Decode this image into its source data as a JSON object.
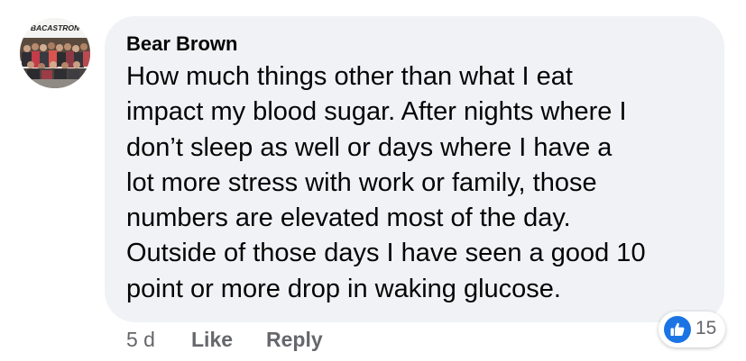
{
  "comment": {
    "author": "Bear Brown",
    "avatar_banner": "BACASTRON",
    "lines": [
      "How much things other than what I eat",
      "impact my blood sugar. After nights where I",
      "don’t sleep as well or days where I have a",
      "lot more stress with work or family, those",
      "numbers are elevated most of the day.",
      "Outside of those days I have seen a good 10",
      "point or more drop in waking glucose."
    ]
  },
  "actions": {
    "time": "5 d",
    "like": "Like",
    "reply": "Reply"
  },
  "reactions": {
    "icon": "thumbs-up-icon",
    "count": "15",
    "color": "#1b74e4"
  }
}
